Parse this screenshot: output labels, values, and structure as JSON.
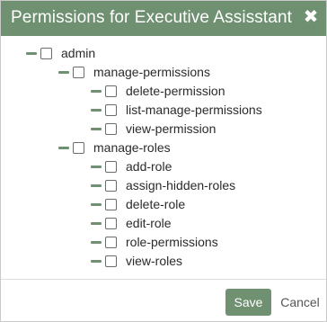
{
  "dialog": {
    "title": "Permissions for Executive Assisstant",
    "close_label": "✖"
  },
  "tree": {
    "admin": {
      "label": "admin",
      "children": {
        "manage_permissions": {
          "label": "manage-permissions",
          "children": [
            {
              "label": "delete-permission",
              "checked": false
            },
            {
              "label": "list-manage-permissions",
              "checked": false
            },
            {
              "label": "view-permission",
              "checked": false
            }
          ],
          "checked": false
        },
        "manage_roles": {
          "label": "manage-roles",
          "children": [
            {
              "label": "add-role",
              "checked": false
            },
            {
              "label": "assign-hidden-roles",
              "checked": false
            },
            {
              "label": "delete-role",
              "checked": false
            },
            {
              "label": "edit-role",
              "checked": false
            },
            {
              "label": "role-permissions",
              "checked": false
            },
            {
              "label": "view-roles",
              "checked": false
            }
          ],
          "checked": false
        }
      },
      "checked": false
    }
  },
  "footer": {
    "save_label": "Save",
    "cancel_label": "Cancel"
  },
  "colors": {
    "accent": "#6f9172",
    "title_text": "#ffffff",
    "text": "#2b2b2b"
  }
}
